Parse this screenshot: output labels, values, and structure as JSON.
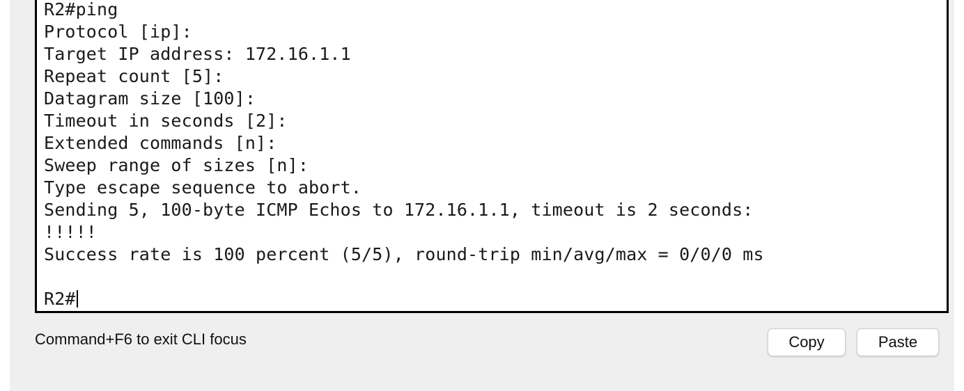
{
  "terminal": {
    "lines": [
      "R2#ping",
      "Protocol [ip]:",
      "Target IP address: 172.16.1.1",
      "Repeat count [5]:",
      "Datagram size [100]:",
      "Timeout in seconds [2]:",
      "Extended commands [n]:",
      "Sweep range of sizes [n]:",
      "Type escape sequence to abort.",
      "Sending 5, 100-byte ICMP Echos to 172.16.1.1, timeout is 2 seconds:",
      "!!!!!",
      "Success rate is 100 percent (5/5), round-trip min/avg/max = 0/0/0 ms",
      "",
      "R2#"
    ]
  },
  "footer": {
    "hint": "Command+F6 to exit CLI focus",
    "copy_label": "Copy",
    "paste_label": "Paste"
  }
}
